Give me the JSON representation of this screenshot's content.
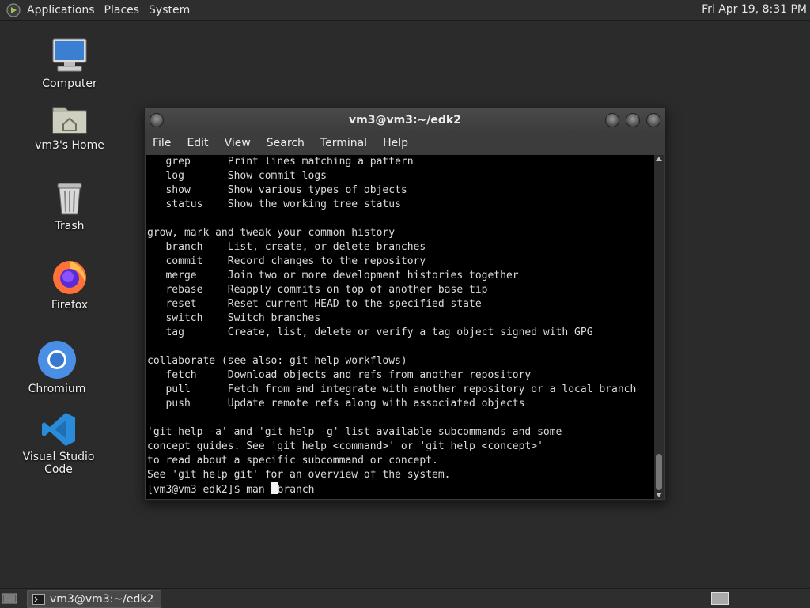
{
  "top_panel": {
    "menus": [
      "Applications",
      "Places",
      "System"
    ],
    "clock": "Fri Apr 19,  8:31 PM"
  },
  "desktop_icons": {
    "computer": "Computer",
    "home": "vm3's Home",
    "trash": "Trash",
    "firefox": "Firefox",
    "chromium": "Chromium",
    "vscode": "Visual Studio Code"
  },
  "terminal": {
    "title": "vm3@vm3:~/edk2",
    "menu": [
      "File",
      "Edit",
      "View",
      "Search",
      "Terminal",
      "Help"
    ],
    "lines": [
      "   grep      Print lines matching a pattern",
      "   log       Show commit logs",
      "   show      Show various types of objects",
      "   status    Show the working tree status",
      "",
      "grow, mark and tweak your common history",
      "   branch    List, create, or delete branches",
      "   commit    Record changes to the repository",
      "   merge     Join two or more development histories together",
      "   rebase    Reapply commits on top of another base tip",
      "   reset     Reset current HEAD to the specified state",
      "   switch    Switch branches",
      "   tag       Create, list, delete or verify a tag object signed with GPG",
      "",
      "collaborate (see also: git help workflows)",
      "   fetch     Download objects and refs from another repository",
      "   pull      Fetch from and integrate with another repository or a local branch",
      "   push      Update remote refs along with associated objects",
      "",
      "'git help -a' and 'git help -g' list available subcommands and some",
      "concept guides. See 'git help <command>' or 'git help <concept>'",
      "to read about a specific subcommand or concept.",
      "See 'git help git' for an overview of the system."
    ],
    "prompt": "[vm3@vm3 edk2]$ man ",
    "after_cursor": "branch"
  },
  "taskbar": {
    "task_label": "vm3@vm3:~/edk2"
  },
  "colors": {
    "desktop_bg": "#2b2b2b",
    "terminal_bg": "#000000",
    "terminal_fg": "#dcdcdc",
    "panel_bg": "#2e2e2e"
  }
}
